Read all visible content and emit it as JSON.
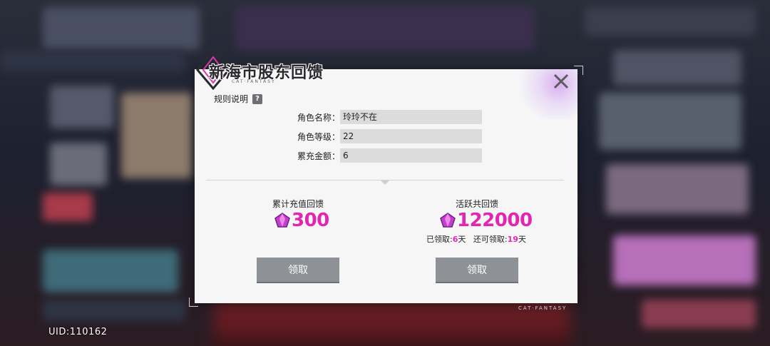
{
  "background": {
    "uid_label": "UID:110162"
  },
  "dialog": {
    "title": "新海市股东回馈",
    "title_sub": "CAT·FANTASY",
    "rules_label": "规则说明",
    "rules_icon": "?",
    "close_icon": "close-icon",
    "fields": [
      {
        "label": "角色名称：",
        "value": "玲玲不在"
      },
      {
        "label": "角色等级：",
        "value": "22"
      },
      {
        "label": "累充金额：",
        "value": "6"
      }
    ],
    "left_panel": {
      "title": "累计充值回馈",
      "amount": "300",
      "button": "领取"
    },
    "right_panel": {
      "title": "活跃共回馈",
      "amount": "122000",
      "claimed_label": "已领取:",
      "claimed_value": "6",
      "claimed_unit": "天",
      "remaining_label": "还可领取:",
      "remaining_value": "19",
      "remaining_unit": "天",
      "button": "领取"
    },
    "footer_brand": "CAT·FANTASY"
  },
  "colors": {
    "accent": "#e226b4",
    "button": "#8e9195",
    "panel": "#f6f6f7"
  }
}
